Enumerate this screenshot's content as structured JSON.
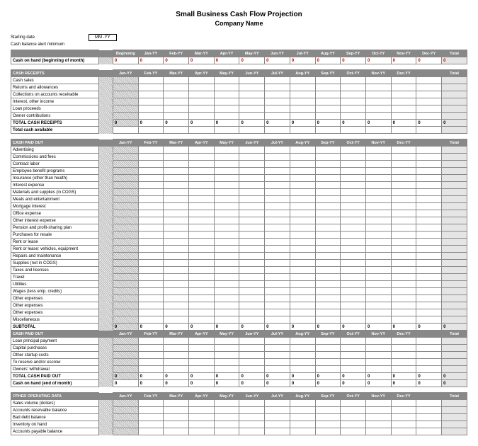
{
  "title": "Small Business Cash Flow Projection",
  "subtitle": "Company Name",
  "meta": {
    "starting_date_label": "Starting date",
    "starting_date_value": "MM -YY",
    "alert_label": "Cash balance alert minimum"
  },
  "months": [
    "Jan-YY",
    "Feb-YY",
    "Mar-YY",
    "Apr-YY",
    "May-YY",
    "Jun-YY",
    "Jul-YY",
    "Aug-YY",
    "Sep-YY",
    "Oct-YY",
    "Nov-YY",
    "Dec-YY"
  ],
  "beginning_label": "Beginning",
  "total_label": "Total",
  "cash_on_hand_begin": "Cash on hand (beginning of month)",
  "zero": "0",
  "sections": {
    "receipts": {
      "title": "CASH RECEIPTS",
      "rows": [
        "Cash sales",
        "Returns and allowances",
        "Collections on accounts receivable",
        "Interest, other income",
        "Loan proceeds",
        "Owner contributions"
      ],
      "total_row": "TOTAL CASH RECEIPTS",
      "available": "Total cash available"
    },
    "paidout": {
      "title": "CASH PAID OUT",
      "rows": [
        "Advertising",
        "Commissions and fees",
        "Contract labor",
        "Employee benefit programs",
        "Insurance (other than health)",
        "Interest expense",
        "Materials and supplies (in COGS)",
        "Meals and entertainment",
        "Mortgage interest",
        "Office expense",
        "Other interest expense",
        "Pension and profit-sharing plan",
        "Purchases for resale",
        "Rent or lease",
        "Rent or lease: vehicles, equipment",
        "Repairs and maintenance",
        "Supplies (not in COGS)",
        "Taxes and licenses",
        "Travel",
        "Utilities",
        "Wages (less emp. credits)",
        "Other expenses",
        "Other expenses",
        "Other expenses",
        "Miscellaneous"
      ],
      "subtotal": "SUBTOTAL",
      "title2": "CASH PAID OUT",
      "rows2": [
        "Loan principal payment",
        "Capital purchases",
        "Other startup costs",
        "To reserve and/or escrow",
        "Owners' withdrawal"
      ],
      "total_row": "TOTAL CASH PAID OUT",
      "end": "Cash on hand (end of month)"
    },
    "other": {
      "title": "OTHER OPERATING DATA",
      "rows": [
        "Sales volume (dollars)",
        "Accounts receivable balance",
        "Bad debt balance",
        "Inventory on hand",
        "Accounts payable balance"
      ]
    }
  }
}
